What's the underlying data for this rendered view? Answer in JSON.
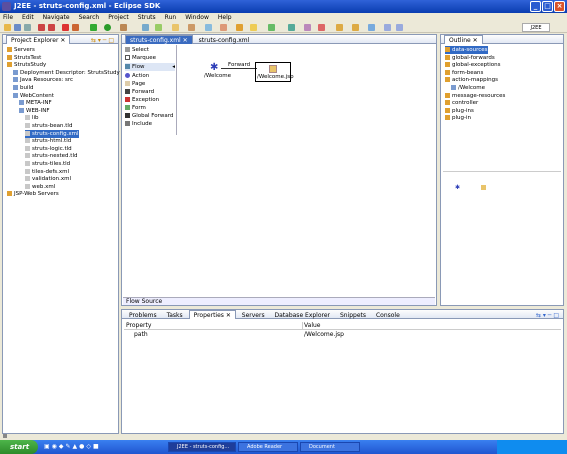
{
  "window": {
    "title": "J2EE - struts-config.xml - Eclipse SDK"
  },
  "menubar": [
    "File",
    "Edit",
    "Navigate",
    "Search",
    "Project",
    "Struts",
    "Run",
    "Window",
    "Help"
  ],
  "perspective": {
    "label": "J2EE"
  },
  "project_explorer": {
    "tab": "Project Explorer",
    "items": [
      {
        "label": "Servers",
        "indent": 1
      },
      {
        "label": "StrutsTest",
        "indent": 1
      },
      {
        "label": "StrutsStudy",
        "indent": 1
      },
      {
        "label": "Deployment Descriptor: StrutsStudy",
        "indent": 2
      },
      {
        "label": "Java Resources: src",
        "indent": 2
      },
      {
        "label": "build",
        "indent": 2
      },
      {
        "label": "WebContent",
        "indent": 2
      },
      {
        "label": "META-INF",
        "indent": 3
      },
      {
        "label": "WEB-INF",
        "indent": 3
      },
      {
        "label": "lib",
        "indent": 4
      },
      {
        "label": "struts-bean.tld",
        "indent": 4
      },
      {
        "label": "struts-config.xml",
        "indent": 4,
        "selected": true
      },
      {
        "label": "struts-html.tld",
        "indent": 4
      },
      {
        "label": "struts-logic.tld",
        "indent": 4
      },
      {
        "label": "struts-nested.tld",
        "indent": 4
      },
      {
        "label": "struts-tiles.tld",
        "indent": 4
      },
      {
        "label": "tiles-defs.xml",
        "indent": 4
      },
      {
        "label": "validation.xml",
        "indent": 4
      },
      {
        "label": "web.xml",
        "indent": 4
      },
      {
        "label": "JSP-Web Servers",
        "indent": 1
      }
    ]
  },
  "editor": {
    "tabs": [
      "struts-config.xml",
      "struts-config.xml"
    ],
    "palette": [
      "Select",
      "Marquee",
      "Flow",
      "Action",
      "Page",
      "Forward",
      "Exception",
      "Form",
      "Global Forward",
      "Include"
    ],
    "nodes": [
      {
        "label": "/Welcome"
      },
      {
        "label": "/Welcome.jsp"
      }
    ],
    "edge_label": "Forward",
    "bottom_tabs": "Flow Source"
  },
  "outline": {
    "tab": "Outline",
    "items": [
      {
        "label": "data-sources",
        "indent": 1,
        "selected": true
      },
      {
        "label": "global-forwards",
        "indent": 1
      },
      {
        "label": "global-exceptions",
        "indent": 1
      },
      {
        "label": "form-beans",
        "indent": 1
      },
      {
        "label": "action-mappings",
        "indent": 1
      },
      {
        "label": "/Welcome",
        "indent": 2
      },
      {
        "label": "message-resources",
        "indent": 1
      },
      {
        "label": "controller",
        "indent": 1
      },
      {
        "label": "plug-ins",
        "indent": 1
      },
      {
        "label": "plug-in",
        "indent": 1
      }
    ]
  },
  "bottom_panel": {
    "tabs": [
      "Problems",
      "Tasks",
      "Properties",
      "Servers",
      "Database Explorer",
      "Snippets",
      "Console"
    ],
    "columns": [
      "Property",
      "Value"
    ],
    "rows": [
      {
        "property": "path",
        "value": "/Welcome.jsp"
      }
    ]
  },
  "taskbar": {
    "start": "start",
    "tasks": [
      "J2EE - struts-config...",
      "Adobe Reader",
      "Document"
    ],
    "tray_time": ""
  }
}
